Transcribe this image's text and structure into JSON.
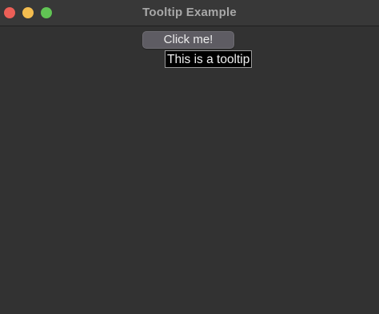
{
  "window": {
    "title": "Tooltip Example"
  },
  "titlebar": {
    "buttons": [
      {
        "name": "close",
        "color": "#ec5f57"
      },
      {
        "name": "minimize",
        "color": "#f4bd4f"
      },
      {
        "name": "zoom",
        "color": "#61c454"
      }
    ]
  },
  "main": {
    "button_label": "Click me!",
    "tooltip_text": "This is a tooltip"
  },
  "colors": {
    "background": "#323232",
    "button": "#5e5c63",
    "tooltip_bg": "#000000"
  }
}
